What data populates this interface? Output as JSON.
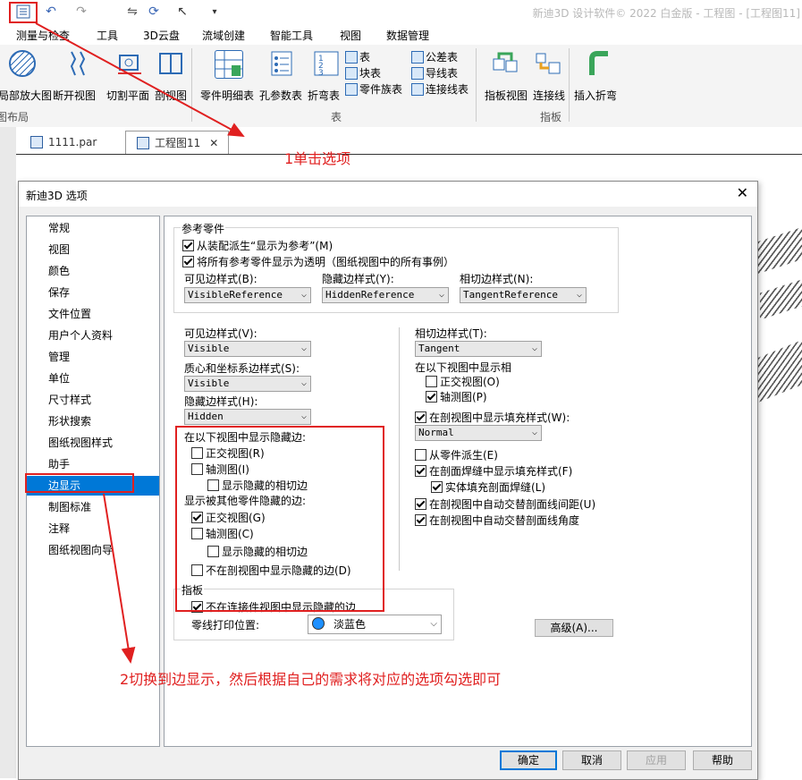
{
  "app": {
    "title": "新迪3D 设计软件© 2022 白金版 - 工程图 - [工程图11]"
  },
  "menus": [
    "测量与检查",
    "工具",
    "3D云盘",
    "流域创建",
    "智能工具",
    "视图",
    "数据管理"
  ],
  "ribbon": {
    "buttons": {
      "detail_view": "局部放大图",
      "break_view": "断开视图",
      "cutting_plane": "切割平面",
      "section_view": "剖视图",
      "parts_list": "零件明细表",
      "hole_table": "孔参数表",
      "bend_table": "折弯表",
      "sheet_view": "指板视图",
      "connect_line": "连接线",
      "insert_bend": "插入折弯"
    },
    "small": {
      "table": "表",
      "block_table": "块表",
      "family_table": "零件族表",
      "tolerance_table": "公差表",
      "wire_table": "导线表",
      "connector_table": "连接线表"
    },
    "groups": {
      "layout": "图布局",
      "table": "表",
      "harness": "指板"
    }
  },
  "doc_tabs": [
    {
      "label": "1111.par"
    },
    {
      "label": "工程图11"
    }
  ],
  "doc_tab_close": "✕",
  "dialog": {
    "title": "新迪3D 选项",
    "close": "✕",
    "nav": [
      "常规",
      "视图",
      "颜色",
      "保存",
      "文件位置",
      "用户个人资料",
      "管理",
      "单位",
      "尺寸样式",
      "形状搜索",
      "图纸视图样式",
      "助手",
      "边显示",
      "制图标准",
      "注释",
      "图纸视图向导"
    ],
    "selected_nav": "边显示",
    "ref_parts": {
      "group_label": "参考零件",
      "cb1": {
        "label": "从装配派生“显示为参考”(M)",
        "checked": true
      },
      "cb2": {
        "label": "将所有参考零件显示为透明（图纸视图中的所有事例）",
        "checked": true
      },
      "visible_label": "可见边样式(B):",
      "visible_value": "VisibleReference",
      "hidden_label": "隐藏边样式(Y):",
      "hidden_value": "HiddenReference",
      "tangent_label": "相切边样式(N):",
      "tangent_value": "TangentReference"
    },
    "left": {
      "visible_label": "可见边样式(V):",
      "visible_value": "Visible",
      "centroid_label": "质心和坐标系边样式(S):",
      "centroid_value": "Visible",
      "hidden_label": "隐藏边样式(H):",
      "hidden_value": "Hidden",
      "show_hidden_label": "在以下视图中显示隐藏边:",
      "ortho1": {
        "label": "正交视图(R)",
        "checked": false
      },
      "axo1": {
        "label": "轴测图(I)",
        "checked": false
      },
      "tan1": {
        "label": "显示隐藏的相切边",
        "checked": false
      },
      "other_hidden_label": "显示被其他零件隐藏的边:",
      "ortho2": {
        "label": "正交视图(G)",
        "checked": true
      },
      "axo2": {
        "label": "轴测图(C)",
        "checked": false
      },
      "tan2": {
        "label": "显示隐藏的相切边",
        "checked": false
      },
      "no_section": {
        "label": "不在剖视图中显示隐藏的边(D)",
        "checked": false
      },
      "harness_label": "指板",
      "no_connector": {
        "label": "不在连接件视图中显示隐藏的边",
        "checked": true
      },
      "zero_print_label": "零线打印位置:",
      "zero_print_value": "淡蓝色",
      "zero_print_color": "#1e90ff"
    },
    "right": {
      "tangent_label": "相切边样式(T):",
      "tangent_value": "Tangent",
      "show_in_label": "在以下视图中显示相",
      "ortho": {
        "label": "正交视图(O)",
        "checked": false
      },
      "axo": {
        "label": "轴测图(P)",
        "checked": true
      },
      "fill_style": {
        "label": "在剖视图中显示填充样式(W):",
        "checked": true
      },
      "fill_value": "Normal",
      "derive": {
        "label": "从零件派生(E)",
        "checked": false
      },
      "weld_fill": {
        "label": "在剖面焊缝中显示填充样式(F)",
        "checked": true
      },
      "solid_weld": {
        "label": "实体填充剖面焊缝(L)",
        "checked": true
      },
      "alt_spacing": {
        "label": "在剖视图中自动交替剖面线间距(U)",
        "checked": true
      },
      "alt_angle": {
        "label": "在剖视图中自动交替剖面线角度",
        "checked": true
      }
    },
    "advanced": "高级(A)...",
    "buttons": {
      "ok": "确定",
      "cancel": "取消",
      "apply": "应用",
      "help": "帮助"
    }
  },
  "annotations": {
    "step1": "1单击选项",
    "step2": "2切换到边显示，然后根据自己的需求将对应的选项勾选即可",
    "color": "#e02020"
  }
}
